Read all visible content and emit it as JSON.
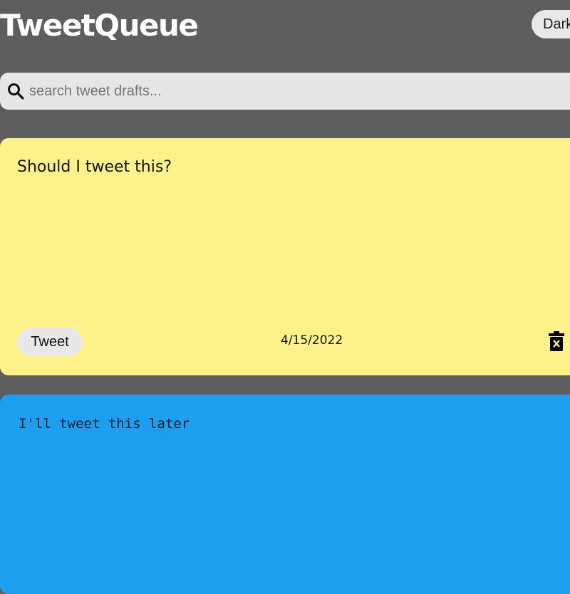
{
  "header": {
    "title": "TweetQueue",
    "theme_toggle_label": "Dark"
  },
  "search": {
    "placeholder": "search tweet drafts...",
    "icon": "search-icon"
  },
  "drafts": [
    {
      "text": "Should I tweet this?",
      "tweet_button_label": "Tweet",
      "date": "4/15/2022",
      "delete_icon": "trash-icon",
      "color": "#fdf28a"
    },
    {
      "text": "I'll tweet this later",
      "color": "#1d9ff0"
    }
  ],
  "colors": {
    "background": "#5e5e5e",
    "search_bg": "#e6e6e6",
    "button_bg": "#e8e8e8"
  }
}
